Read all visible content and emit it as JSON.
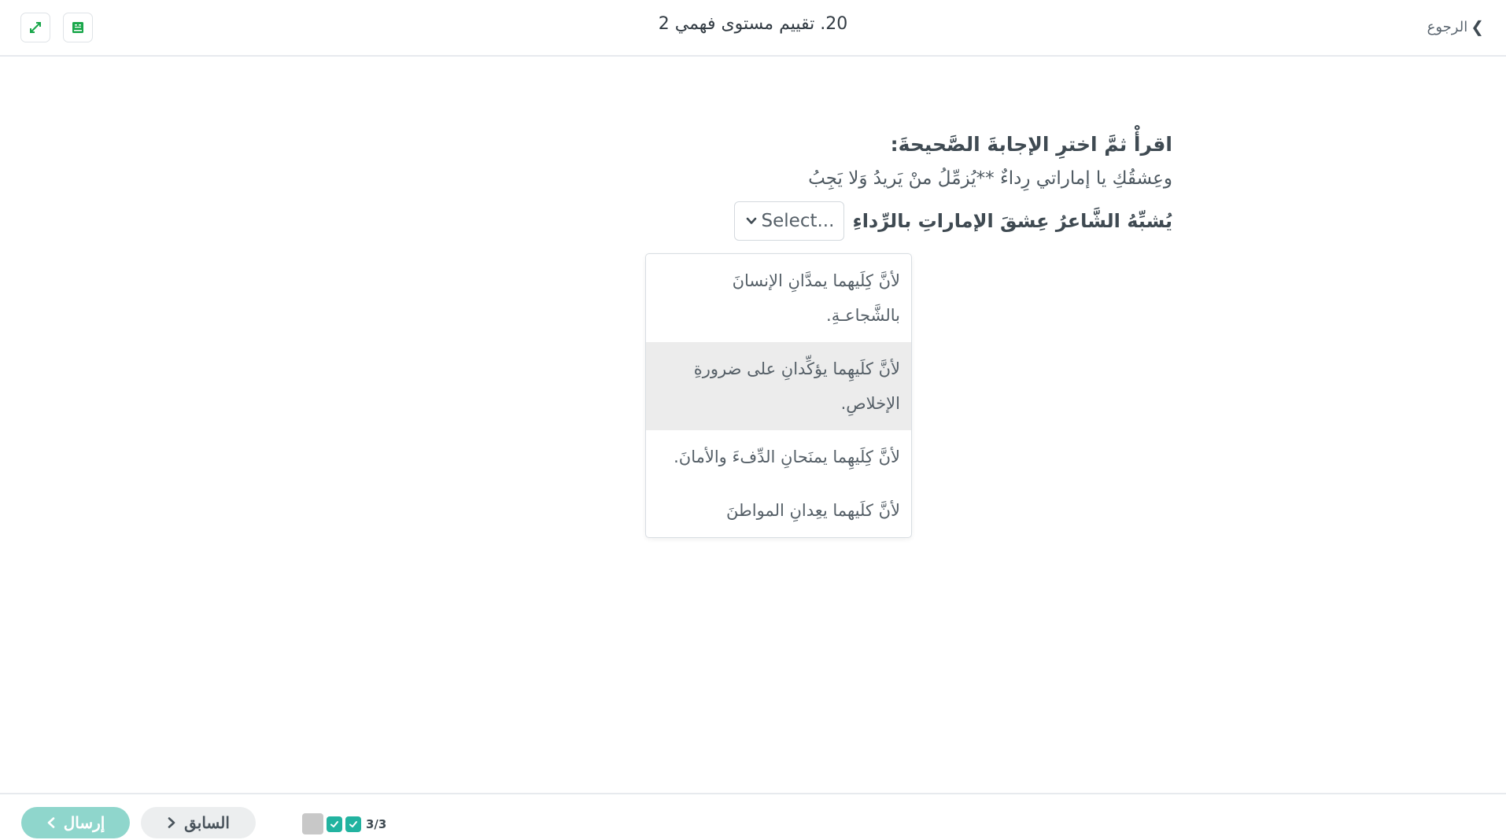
{
  "header": {
    "back_label": "الرجوع",
    "title": "20. تقييم مستوى فهمي 2"
  },
  "question": {
    "instruction": "اقرأْ ثمَّ اخترِ الإجابةَ الصَّحيحةَ:",
    "verse": "وعِشقُكِ يا إماراتي رِداءٌ **يُزمِّلُ منْ يَريدُ وَلا يَجِبُ",
    "stem": "يُشبِّهُ الشَّاعرُ عِشقَ الإماراتِ بالرِّداءِ",
    "select_placeholder": "Select..."
  },
  "dropdown": {
    "options": [
      "لأنَّ كِلَيهما يمدَّانِ الإنسانَ بالشَّجاعـةِ.",
      "لأنَّ كلَيهِما يؤكِّدانِ على ضرورةِ الإخلاصِ.",
      "لأنَّ كِلَيهِما يمنَحانِ الدِّفءَ والأمانَ.",
      "لأنَّ كلَيهما يعِدانِ المواطنَ"
    ],
    "highlighted_index": 1
  },
  "footer": {
    "send_label": "إرسال",
    "prev_label": "السابق",
    "progress_text": "3/3"
  },
  "colors": {
    "accent": "#22b3a0",
    "send_disabled": "#8fd6cc",
    "icon_green": "#1aa74b"
  }
}
